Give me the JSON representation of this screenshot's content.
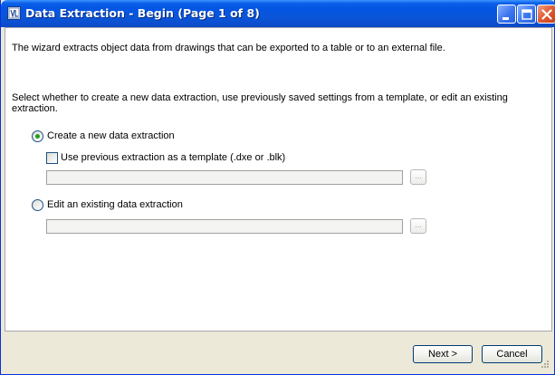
{
  "window": {
    "title": "Data Extraction - Begin (Page 1 of 8)",
    "icon": "data-extraction-app-icon"
  },
  "title_buttons": {
    "minimize_icon": "minimize-icon",
    "maximize_icon": "maximize-icon",
    "close_icon": "close-icon"
  },
  "content": {
    "intro": "The wizard extracts object data from drawings that can be exported to a table or to an external file.",
    "instruction": "Select whether to create a new data extraction, use previously saved settings from a template, or edit an existing extraction."
  },
  "options": {
    "create_new": {
      "label": "Create a new data extraction",
      "selected": true
    },
    "use_template": {
      "label": "Use previous extraction as a template (.dxe or .blk)",
      "checked": false,
      "path_value": "",
      "browse_label": "..."
    },
    "edit_existing": {
      "label": "Edit an existing data extraction",
      "selected": false,
      "path_value": "",
      "browse_label": "..."
    }
  },
  "footer": {
    "next_label": "Next >",
    "cancel_label": "Cancel"
  },
  "colors": {
    "titlebar_blue": "#0455e3",
    "dialog_face": "#ece9d8",
    "radio_selected_dot": "#21a121"
  }
}
